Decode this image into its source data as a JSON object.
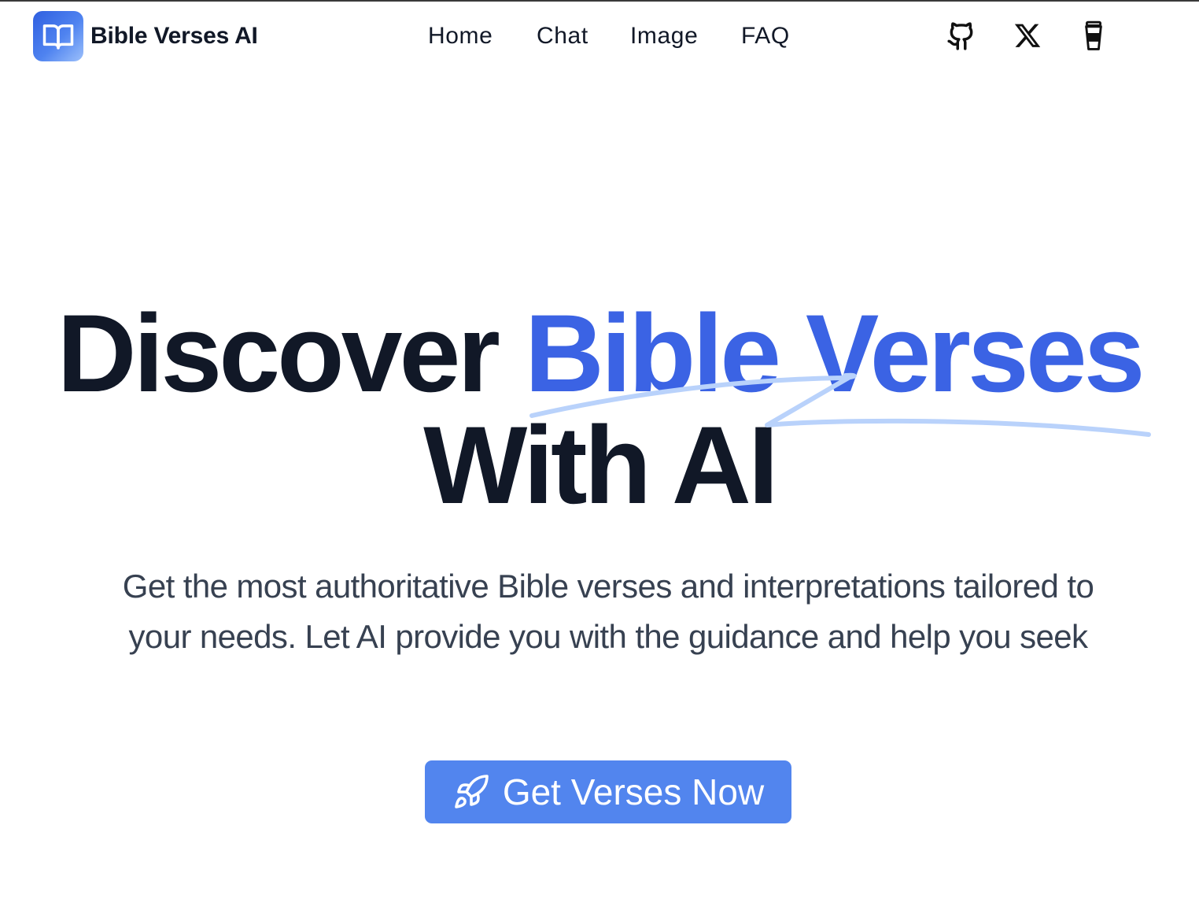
{
  "header": {
    "brand": "Bible Verses AI",
    "nav": [
      {
        "label": "Home"
      },
      {
        "label": "Chat"
      },
      {
        "label": "Image"
      },
      {
        "label": "FAQ"
      }
    ],
    "icons": [
      "github-icon",
      "x-icon",
      "coffee-cup-icon"
    ]
  },
  "hero": {
    "title_part1": "Discover",
    "title_accent": "Bible Verses",
    "title_line2": "With AI",
    "subtitle_line1": "Get the most authoritative Bible verses and interpretations tailored to",
    "subtitle_line2": "your needs. Let AI provide you with the guidance and help you seek",
    "cta_label": "Get Verses Now"
  },
  "colors": {
    "accent": "#3b63e4",
    "button": "#5285ee",
    "scribble": "#b9d2fb",
    "text": "#111827",
    "subtext": "#374151"
  }
}
